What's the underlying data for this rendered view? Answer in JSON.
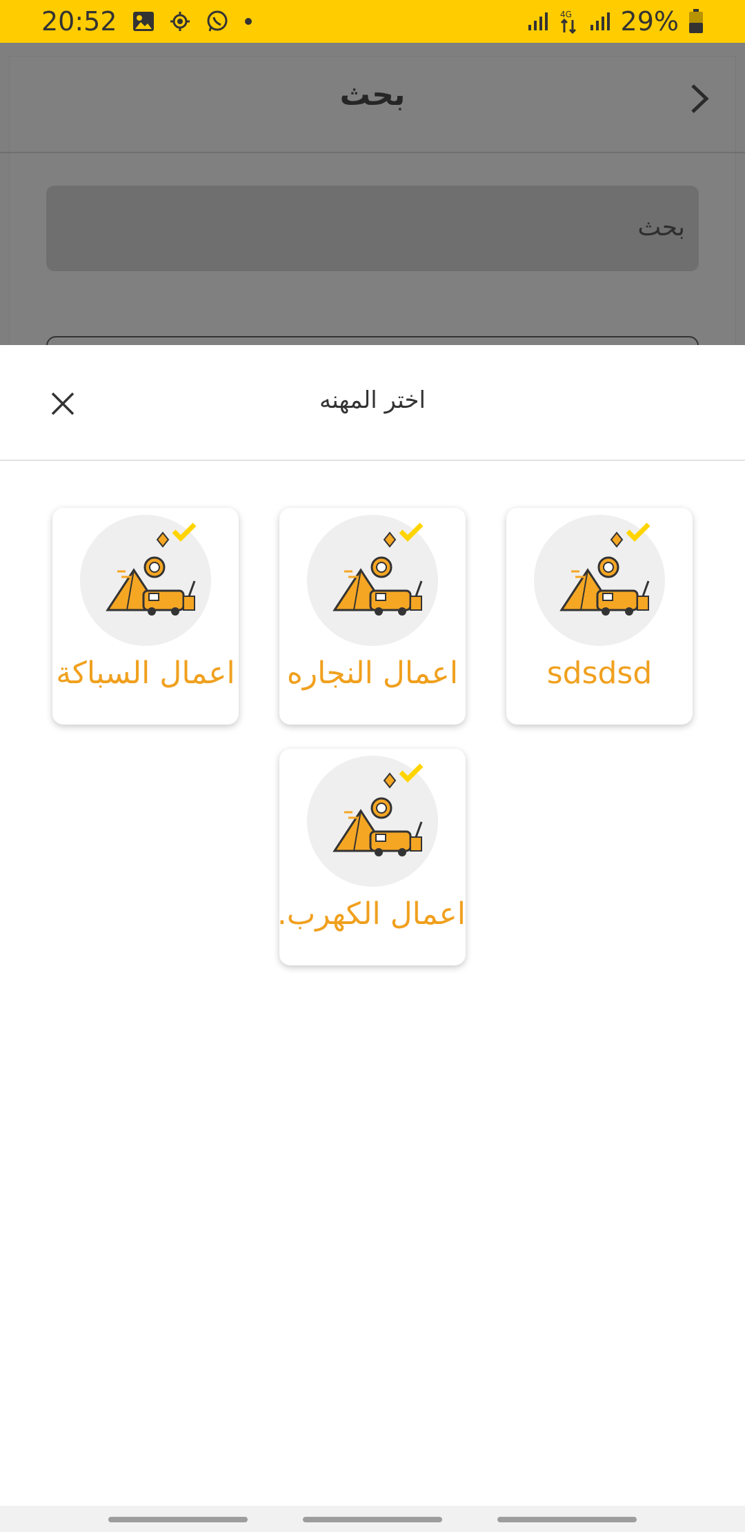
{
  "status_bar": {
    "time": "20:52",
    "network": "4G",
    "battery": "29%",
    "icons": [
      "image-icon",
      "location-icon",
      "whatsapp-icon",
      "dot-icon",
      "signal-icon",
      "data-arrows-icon",
      "signal-icon",
      "battery-icon"
    ]
  },
  "background_page": {
    "title": "بحث",
    "search_placeholder": "بحث"
  },
  "sheet": {
    "title": "اختر المهنه",
    "close_icon": "close-icon",
    "items": [
      {
        "label": "sdsdsd",
        "icon": "camping-illustration"
      },
      {
        "label": "اعمال النجاره",
        "icon": "camping-illustration"
      },
      {
        "label": "اعمال السباكة",
        "icon": "camping-illustration"
      },
      {
        "label": "اعمال الكهرب.",
        "icon": "camping-illustration"
      }
    ]
  },
  "colors": {
    "status_bar": "#FFCC00",
    "label": "#F0A01E",
    "illustration": "#F5A623",
    "check": "#FFD400"
  }
}
